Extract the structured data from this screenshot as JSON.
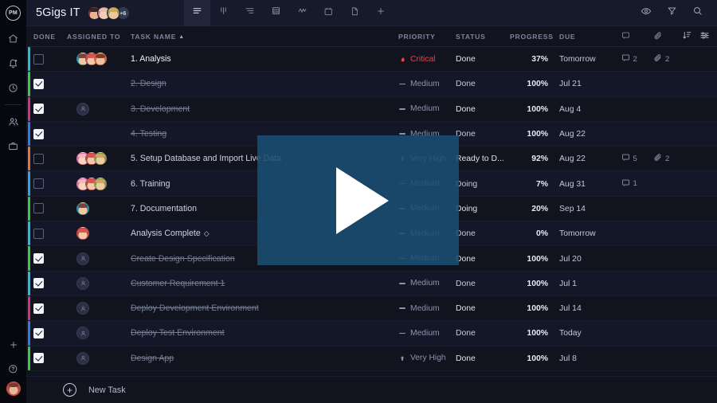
{
  "rail": {
    "logo": "PM",
    "items": [
      {
        "name": "home-icon",
        "label": "Home"
      },
      {
        "name": "notifications-icon",
        "label": "Notifications"
      },
      {
        "name": "time-icon",
        "label": "Time Tracking"
      },
      {
        "name": "people-icon",
        "label": "People"
      },
      {
        "name": "portfolio-icon",
        "label": "Portfolio"
      }
    ],
    "bottom": [
      {
        "name": "add-icon",
        "label": "Add"
      },
      {
        "name": "help-icon",
        "label": "Help"
      },
      {
        "name": "user-avatar",
        "label": "Account"
      }
    ]
  },
  "topbar": {
    "project_title": "5Gigs IT",
    "member_overflow": "+6",
    "views": [
      {
        "name": "list-view",
        "label": "List",
        "active": true
      },
      {
        "name": "gantt-view",
        "label": "Gantt",
        "active": false
      },
      {
        "name": "workload-view",
        "label": "Workload",
        "active": false
      },
      {
        "name": "board-view",
        "label": "Board",
        "active": false
      },
      {
        "name": "chart-view",
        "label": "Chart",
        "active": false
      },
      {
        "name": "calendar-view",
        "label": "Calendar",
        "active": false
      },
      {
        "name": "files-view",
        "label": "Files",
        "active": false
      },
      {
        "name": "add-view",
        "label": "Add View",
        "active": false
      }
    ],
    "actions": [
      {
        "name": "visibility-icon",
        "label": "Show / Hide"
      },
      {
        "name": "filter-icon",
        "label": "Filter"
      },
      {
        "name": "search-icon",
        "label": "Search"
      }
    ]
  },
  "columns": {
    "done": "DONE",
    "assigned_to": "ASSIGNED TO",
    "task_name": "TASK NAME",
    "task_name_sort": "▲",
    "priority": "PRIORITY",
    "status": "STATUS",
    "progress": "PROGRESS",
    "due": "DUE",
    "comment_icon": "comment-icon",
    "attachment_icon": "paperclip-icon",
    "sort_icon": "sort-descending-icon",
    "settings_icon": "column-settings-icon"
  },
  "rows": [
    {
      "bar": "#25c0d8",
      "done": false,
      "name": "1. Analysis",
      "struck": false,
      "highlight": true,
      "avatars": [
        "p-teal",
        "p-red",
        "p-orange"
      ],
      "priority": "Critical",
      "priority_kind": "critical",
      "status": "Done",
      "progress": "37%",
      "due": "Tomorrow",
      "comments": "2",
      "attachments": "2"
    },
    {
      "bar": "#3ec94a",
      "done": true,
      "name": "2. Design",
      "struck": true,
      "highlight": false,
      "avatars": [],
      "priority": "Medium",
      "priority_kind": "medium",
      "status": "Done",
      "progress": "100%",
      "due": "Jul 21",
      "comments": "",
      "attachments": ""
    },
    {
      "bar": "#d6317f",
      "done": true,
      "name": "3. Development",
      "struck": true,
      "highlight": false,
      "avatars": [
        "ghost"
      ],
      "priority": "Medium",
      "priority_kind": "medium",
      "status": "Done",
      "progress": "100%",
      "due": "Aug 4",
      "comments": "",
      "attachments": ""
    },
    {
      "bar": "#2f7de0",
      "done": true,
      "name": "4. Testing",
      "struck": true,
      "highlight": false,
      "avatars": [],
      "priority": "Medium",
      "priority_kind": "medium",
      "status": "Done",
      "progress": "100%",
      "due": "Aug 22",
      "comments": "",
      "attachments": ""
    },
    {
      "bar": "#e8743a",
      "done": false,
      "name": "5. Setup Database and Import Live Data",
      "struck": false,
      "highlight": false,
      "avatars": [
        "p-pink",
        "p-red",
        "p-olive"
      ],
      "priority": "Very High",
      "priority_kind": "veryhigh",
      "status": "Ready to D...",
      "progress": "92%",
      "due": "Aug 22",
      "comments": "5",
      "attachments": "2"
    },
    {
      "bar": "#2aa7e0",
      "done": false,
      "name": "6. Training",
      "struck": false,
      "highlight": false,
      "avatars": [
        "p-pink",
        "p-red",
        "p-olive"
      ],
      "priority": "Medium",
      "priority_kind": "medium",
      "status": "Doing",
      "progress": "7%",
      "due": "Aug 31",
      "comments": "1",
      "attachments": ""
    },
    {
      "bar": "#3ec94a",
      "done": false,
      "name": "7. Documentation",
      "struck": false,
      "highlight": false,
      "avatars": [
        "p-teal"
      ],
      "priority": "Medium",
      "priority_kind": "medium",
      "status": "Doing",
      "progress": "20%",
      "due": "Sep 14",
      "comments": "",
      "attachments": ""
    },
    {
      "bar": "#25c0d8",
      "done": false,
      "name": "Analysis Complete",
      "struck": false,
      "highlight": false,
      "milestone": "◇",
      "avatars": [
        "p-red"
      ],
      "priority": "Medium",
      "priority_kind": "medium",
      "status": "Done",
      "progress": "0%",
      "due": "Tomorrow",
      "comments": "",
      "attachments": ""
    },
    {
      "bar": "#3ec94a",
      "done": true,
      "name": "Create Design Specification",
      "struck": true,
      "highlight": false,
      "avatars": [
        "ghost"
      ],
      "priority": "Medium",
      "priority_kind": "medium",
      "status": "Done",
      "progress": "100%",
      "due": "Jul 20",
      "comments": "",
      "attachments": ""
    },
    {
      "bar": "#25c0d8",
      "done": true,
      "name": "Customer Requirement 1",
      "struck": true,
      "highlight": false,
      "avatars": [
        "ghost"
      ],
      "priority": "Medium",
      "priority_kind": "medium",
      "status": "Done",
      "progress": "100%",
      "due": "Jul 1",
      "comments": "",
      "attachments": ""
    },
    {
      "bar": "#d6317f",
      "done": true,
      "name": "Deploy Development Environment",
      "struck": true,
      "highlight": false,
      "avatars": [
        "ghost"
      ],
      "priority": "Medium",
      "priority_kind": "medium",
      "status": "Done",
      "progress": "100%",
      "due": "Jul 14",
      "comments": "",
      "attachments": ""
    },
    {
      "bar": "#2f7de0",
      "done": true,
      "name": "Deploy Test Environment",
      "struck": true,
      "highlight": false,
      "avatars": [
        "ghost"
      ],
      "priority": "Medium",
      "priority_kind": "medium",
      "status": "Done",
      "progress": "100%",
      "due": "Today",
      "comments": "",
      "attachments": ""
    },
    {
      "bar": "#3ec94a",
      "done": true,
      "name": "Design App",
      "struck": true,
      "highlight": false,
      "avatars": [
        "ghost"
      ],
      "priority": "Very High",
      "priority_kind": "veryhigh",
      "status": "Done",
      "progress": "100%",
      "due": "Jul 8",
      "comments": "",
      "attachments": ""
    }
  ],
  "footer": {
    "new_task_label": "New Task"
  },
  "overlay": {
    "play_label": "Play"
  },
  "colors": {
    "accent_blue": "#1a4e73",
    "critical_red": "#e8414f",
    "panel_bg": "#11131f",
    "topbar_bg": "#171a2a",
    "rail_bg": "#07080e"
  }
}
